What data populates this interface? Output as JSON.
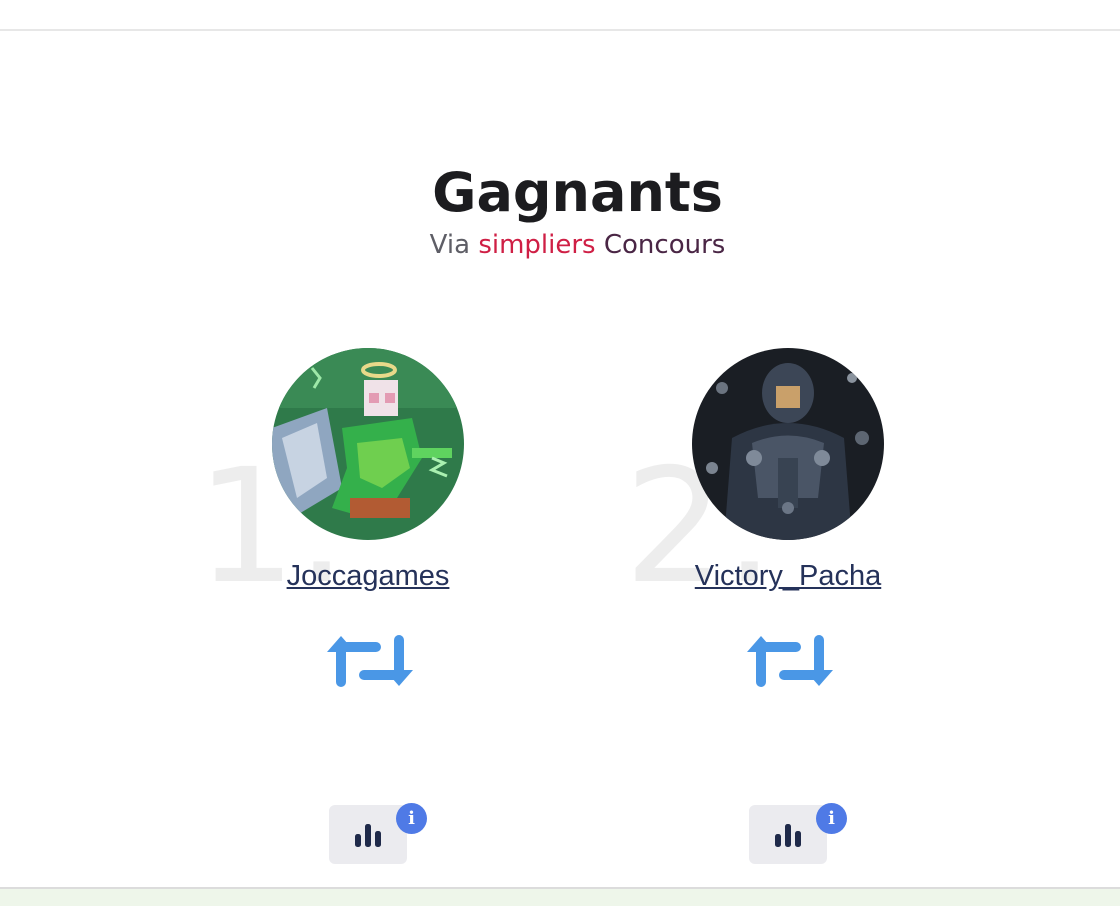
{
  "header": {
    "title": "Gagnants",
    "subtitle_via": "Via",
    "subtitle_brand_a": "simpliers",
    "subtitle_brand_b": "Concours"
  },
  "winners": [
    {
      "rank": "1.",
      "username": "Joccagames",
      "action_icon": "retweet-icon",
      "stats_icon": "bar-chart-icon",
      "info_badge": "i"
    },
    {
      "rank": "2.",
      "username": "Victory_Pacha",
      "action_icon": "retweet-icon",
      "stats_icon": "bar-chart-icon",
      "info_badge": "i"
    }
  ],
  "colors": {
    "title": "#1c1c1f",
    "subtitle": "#5e5e66",
    "brand_primary": "#cf1f45",
    "brand_secondary": "#4a2645",
    "link": "#25325a",
    "retweet": "#4a97e6",
    "info_badge": "#4f7ae6",
    "stats_button_bg": "#ebebef"
  }
}
